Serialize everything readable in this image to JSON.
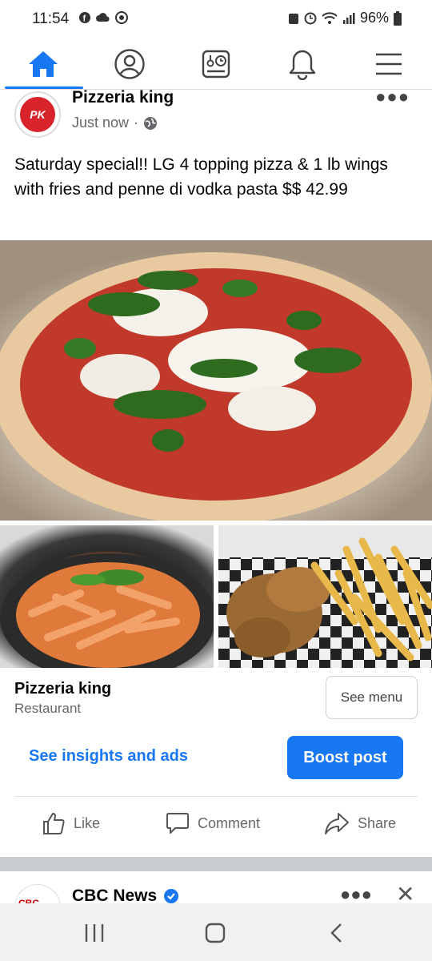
{
  "status_bar": {
    "time": "11:54",
    "battery": "96%"
  },
  "nav": {
    "icons": [
      "home-icon",
      "profile-icon",
      "dashboard-icon",
      "notifications-icon",
      "menu-icon"
    ],
    "accent": "#1877f2"
  },
  "post": {
    "page_name": "Pizzeria king",
    "timestamp": "Just now",
    "separator": "·",
    "text": "Saturday special!! LG 4 topping pizza & 1 lb wings with fries and penne di vodka pasta $$ 42.99",
    "avatar_initials": "PK"
  },
  "page_card": {
    "name": "Pizzeria king",
    "category": "Restaurant",
    "see_menu": "See menu"
  },
  "promo": {
    "insights": "See insights and ads",
    "boost": "Boost post"
  },
  "actions": {
    "like": "Like",
    "comment": "Comment",
    "share": "Share"
  },
  "next_post": {
    "page_name": "CBC News",
    "avatar_text": "CBC"
  },
  "colors": {
    "brand": "#1877f2",
    "secondary_text": "#65676b"
  }
}
